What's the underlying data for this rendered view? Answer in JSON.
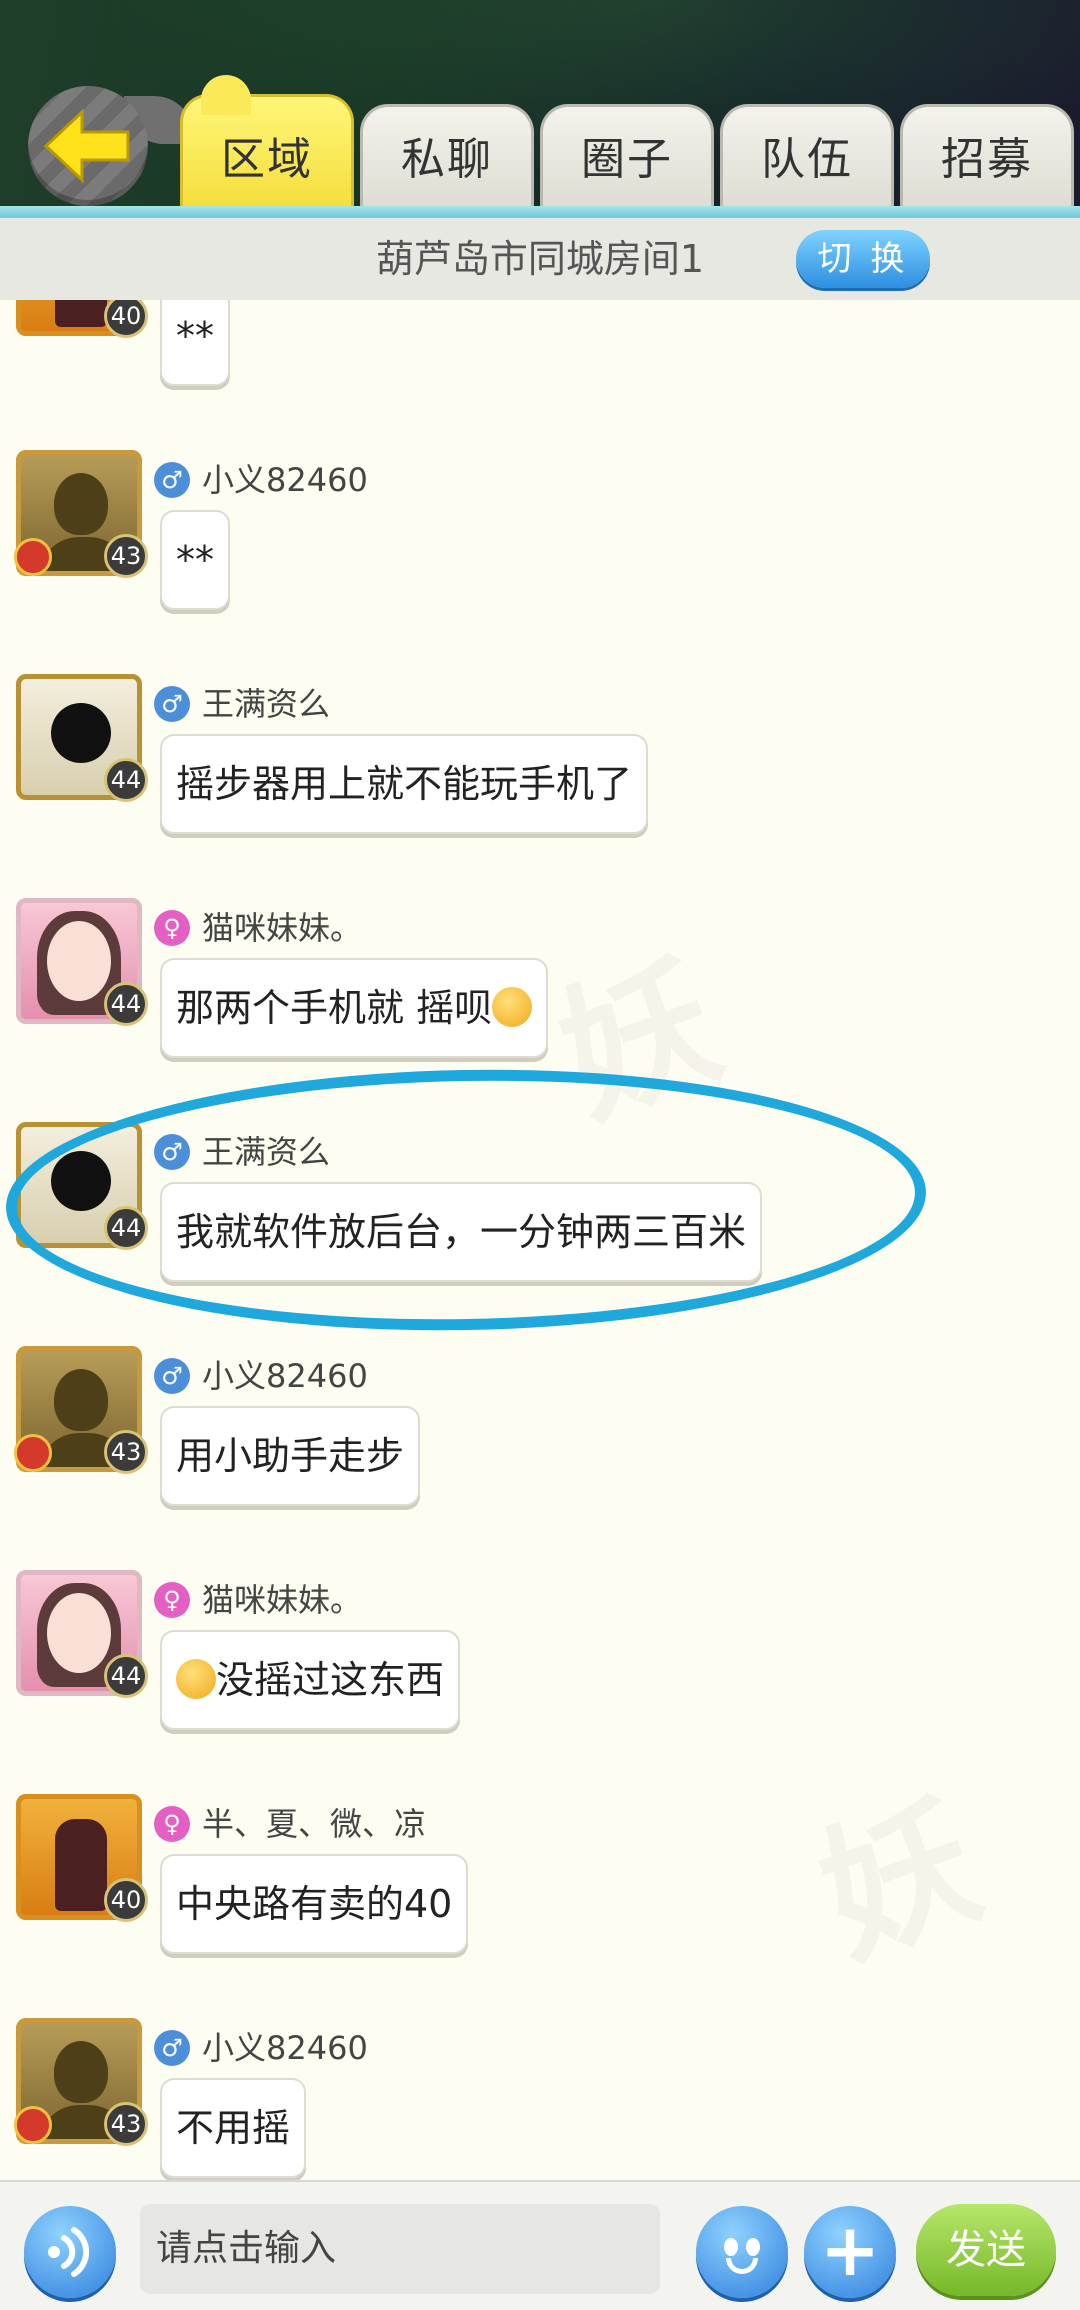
{
  "header": {
    "tabs": [
      {
        "label": "区域",
        "active": true
      },
      {
        "label": "私聊",
        "active": false
      },
      {
        "label": "圈子",
        "active": false
      },
      {
        "label": "队伍",
        "active": false
      },
      {
        "label": "招募",
        "active": false
      }
    ]
  },
  "room": {
    "title": "葫芦岛市同城房间1",
    "switch_label": "切 换"
  },
  "messages": [
    {
      "user": "",
      "gender": "",
      "level": "40",
      "text": "**",
      "avatar": "hero-icon"
    },
    {
      "user": "小义82460",
      "gender": "♂",
      "level": "43",
      "text": "**",
      "avatar": "silhouette-avatar-icon"
    },
    {
      "user": "王满资么",
      "gender": "♂",
      "level": "44",
      "text": "摇步器用上就不能玩手机了",
      "avatar": "ninja-avatar-icon"
    },
    {
      "user": "猫咪妹妹。",
      "gender": "♀",
      "level": "44",
      "text": "那两个手机就 摇呗",
      "avatar": "girl-avatar-icon",
      "emoji": "yawn-emoji"
    },
    {
      "user": "王满资么",
      "gender": "♂",
      "level": "44",
      "text": "我就软件放后台，一分钟两三百米",
      "avatar": "ninja-avatar-icon",
      "highlighted": true
    },
    {
      "user": "小义82460",
      "gender": "♂",
      "level": "43",
      "text": "用小助手走步",
      "avatar": "silhouette-avatar-icon"
    },
    {
      "user": "猫咪妹妹。",
      "gender": "♀",
      "level": "44",
      "text": "没摇过这东西",
      "avatar": "girl-avatar-icon",
      "emoji": "confused-emoji"
    },
    {
      "user": "半、夏、微、凉",
      "gender": "♀",
      "level": "40",
      "text": "中央路有卖的40",
      "avatar": "hero-avatar-icon"
    },
    {
      "user": "小义82460",
      "gender": "♂",
      "level": "43",
      "text": "不用摇",
      "avatar": "silhouette-avatar-icon"
    }
  ],
  "input": {
    "placeholder": "请点击输入"
  },
  "bottom": {
    "send_label": "发送",
    "plus_label": "+"
  },
  "colors": {
    "highlight": "#1fa8dc",
    "active_tab": "#f5dd3a",
    "male": "#4a8fd8",
    "female": "#e45fc3",
    "send": "#76b82a"
  }
}
